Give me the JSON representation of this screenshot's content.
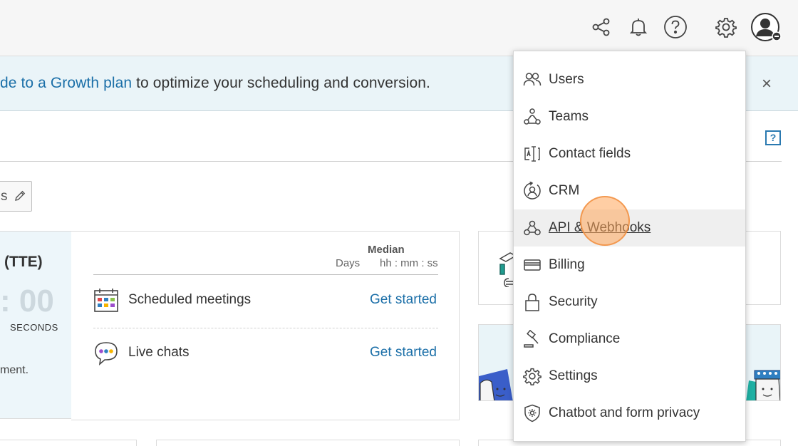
{
  "banner": {
    "link_text": "de to a Growth plan",
    "rest_text": " to optimize your scheduling and conversion.",
    "close_label": "×"
  },
  "topbar": {
    "icons": [
      "share-icon",
      "bell-icon",
      "help-icon",
      "gear-icon",
      "user-avatar-icon"
    ]
  },
  "page": {
    "help_label": "?",
    "edit_chip_text": "s"
  },
  "tte_card": {
    "title": "(TTE)",
    "zeros": ": 00",
    "seconds_label": "SECONDS",
    "footer_text": "ment."
  },
  "metrics": {
    "median_label": "Median",
    "days_label": "Days",
    "time_format_label": "hh : mm : ss",
    "rows": [
      {
        "label": "Scheduled meetings",
        "action": "Get started",
        "icon": "calendar-icon"
      },
      {
        "label": "Live chats",
        "action": "Get started",
        "icon": "chat-icon"
      }
    ]
  },
  "menu": {
    "items": [
      {
        "label": "Users",
        "icon": "users-icon"
      },
      {
        "label": "Teams",
        "icon": "teams-icon"
      },
      {
        "label": "Contact fields",
        "icon": "contact-fields-icon"
      },
      {
        "label": "CRM",
        "icon": "crm-icon"
      },
      {
        "label": "API & Webhooks",
        "icon": "webhooks-icon",
        "highlighted": true
      },
      {
        "label": "Billing",
        "icon": "credit-card-icon"
      },
      {
        "label": "Security",
        "icon": "lock-icon"
      },
      {
        "label": "Compliance",
        "icon": "gavel-icon"
      },
      {
        "label": "Settings",
        "icon": "gear-icon"
      },
      {
        "label": "Chatbot and form privacy",
        "icon": "shield-gear-icon"
      }
    ]
  },
  "colors": {
    "link_blue": "#1b6fa8",
    "banner_bg": "#eaf4f8",
    "menu_highlight": "#efefef",
    "click_indicator": "#f5a05a"
  }
}
